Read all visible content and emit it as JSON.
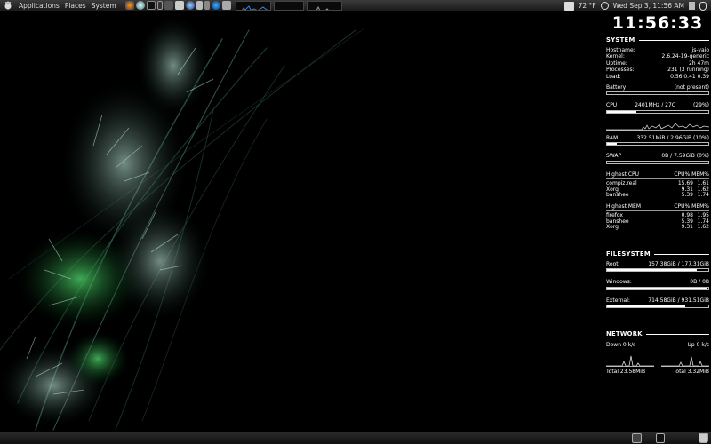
{
  "top_panel": {
    "menus": [
      "Applications",
      "Places",
      "System"
    ],
    "temperature": "72 °F",
    "datetime": "Wed Sep  3, 11:56 AM"
  },
  "conky": {
    "clock": "11:56:33",
    "system": {
      "heading": "SYSTEM",
      "rows": [
        {
          "k": "Hostname:",
          "v": "js-vaio"
        },
        {
          "k": "Kernel:",
          "v": "2.6.24-19-generic"
        },
        {
          "k": "Uptime:",
          "v": "2h 47m"
        },
        {
          "k": "Processes:",
          "v": "231 (3 running)"
        },
        {
          "k": "Load:",
          "v": "0.56 0.41 0.39"
        }
      ],
      "battery_label": "Battery",
      "battery_value": "(not present)",
      "cpu_label": "CPU",
      "cpu_freq": "2401MHz / 27C",
      "cpu_pct": "(29%)",
      "cpu_fill": 0.29,
      "ram_label": "RAM",
      "ram_value": "332.51MiB / 2.96GiB (10%)",
      "ram_fill": 0.1,
      "swap_label": "SWAP",
      "swap_value": "0B / 7.59GiB (0%)",
      "swap_fill": 0.0,
      "highest_cpu": {
        "title": "Highest CPU",
        "cols": "CPU% MEM%",
        "rows": [
          {
            "name": "compiz.real",
            "cpu": "15.69",
            "mem": "1.61"
          },
          {
            "name": "Xorg",
            "cpu": "9.31",
            "mem": "1.62"
          },
          {
            "name": "banshee",
            "cpu": "5.39",
            "mem": "1.74"
          }
        ]
      },
      "highest_mem": {
        "title": "Highest MEM",
        "cols": "CPU% MEM%",
        "rows": [
          {
            "name": "firefox",
            "cpu": "0.98",
            "mem": "1.95"
          },
          {
            "name": "banshee",
            "cpu": "5.39",
            "mem": "1.74"
          },
          {
            "name": "Xorg",
            "cpu": "9.31",
            "mem": "1.62"
          }
        ]
      }
    },
    "filesystem": {
      "heading": "FILESYSTEM",
      "items": [
        {
          "label": "Root:",
          "value": "157.38GiB / 177.31GiB",
          "fill": 0.89
        },
        {
          "label": "Windows:",
          "value": "0B / 0B",
          "fill": 0.99
        },
        {
          "label": "External:",
          "value": "714.58GiB / 931.51GiB",
          "fill": 0.77
        }
      ]
    },
    "network": {
      "heading": "NETWORK",
      "down": "Down 0 k/s",
      "up": "Up 0 k/s",
      "total_down": "Total 23.58MiB",
      "total_up": "Total 3.32MiB"
    }
  },
  "colors": {
    "panel": "#222222",
    "text": "#ffffff",
    "wallpaper_green": "#4fd36a",
    "wallpaper_teal": "#9fd8c4"
  }
}
